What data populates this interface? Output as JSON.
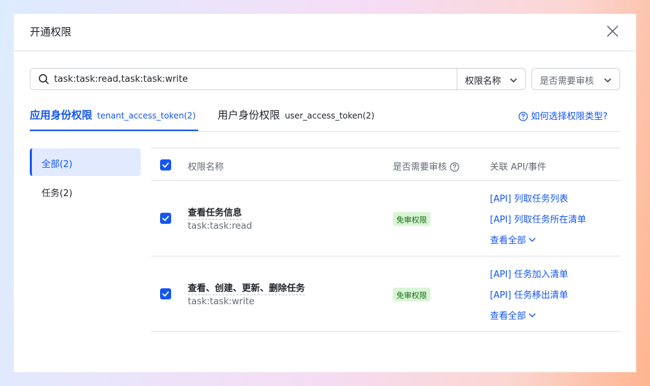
{
  "dialog": {
    "title": "开通权限",
    "close_icon": "close-icon"
  },
  "search": {
    "value": "task:task:read,task:task:write",
    "icon": "search-icon"
  },
  "filters": {
    "field_label": "权限名称",
    "review_placeholder": "是否需要审核"
  },
  "tabs": [
    {
      "label": "应用身份权限",
      "sub": "tenant_access_token(2)",
      "active": true
    },
    {
      "label": "用户身份权限",
      "sub": "user_access_token(2)",
      "active": false
    }
  ],
  "help_link": "如何选择权限类型?",
  "sidebar": {
    "items": [
      {
        "label": "全部(2)",
        "active": true
      },
      {
        "label": "任务(2)",
        "active": false
      }
    ]
  },
  "table": {
    "headers": {
      "name": "权限名称",
      "review": "是否需要审核",
      "api": "关联 API/事件"
    },
    "rows": [
      {
        "checked": true,
        "name": "查看任务信息",
        "key": "task:task:read",
        "review": "免审权限",
        "apis": [
          "[API] 列取任务列表",
          "[API] 列取任务所在清单"
        ],
        "view_all": "查看全部"
      },
      {
        "checked": true,
        "name": "查看、创建、更新、删除任务",
        "key": "task:task:write",
        "review": "免审权限",
        "apis": [
          "[API] 任务加入清单",
          "[API] 任务移出清单"
        ],
        "view_all": "查看全部"
      }
    ]
  },
  "colors": {
    "accent": "#1456f0",
    "badge_bg": "#d9f5d6",
    "badge_text": "#186c18",
    "sidebar_active_bg": "#e1eaff"
  }
}
